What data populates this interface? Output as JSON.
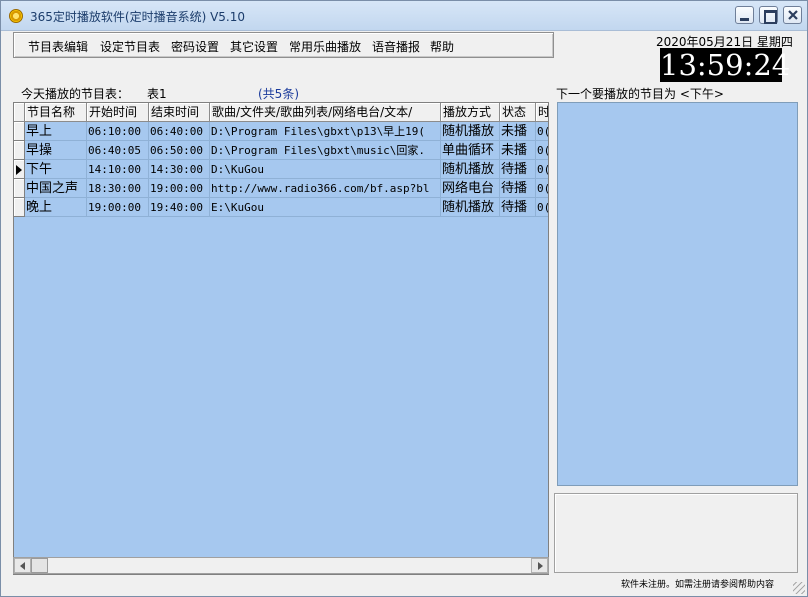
{
  "window": {
    "title": "365定时播放软件(定时播音系统) V5.10"
  },
  "menu": [
    "节目表编辑",
    "设定节目表",
    "密码设置",
    "其它设置",
    "常用乐曲播放",
    "语音播报",
    "帮助"
  ],
  "clock": {
    "date": "2020年05月21日 星期四",
    "time": "13:59:24"
  },
  "schedule": {
    "today_label": "今天播放的节目表：",
    "table_name": "表1",
    "count": "(共5条)",
    "columns": [
      "节目名称",
      "开始时间",
      "结束时间",
      "歌曲/文件夹/歌曲列表/网络电台/文本/",
      "播放方式",
      "状态",
      "时"
    ],
    "rows": [
      {
        "name": "早上",
        "start": "06:10:00",
        "end": "06:40:00",
        "path": "D:\\Program Files\\gbxt\\p13\\早上19(",
        "mode": "随机播放",
        "status": "未播",
        "extra": "0(",
        "active": false
      },
      {
        "name": "早操",
        "start": "06:40:05",
        "end": "06:50:00",
        "path": "D:\\Program Files\\gbxt\\music\\回家.",
        "mode": "单曲循环",
        "status": "未播",
        "extra": "0(",
        "active": false
      },
      {
        "name": "下午",
        "start": "14:10:00",
        "end": "14:30:00",
        "path": "D:\\KuGou",
        "mode": "随机播放",
        "status": "待播",
        "extra": "0(",
        "active": true
      },
      {
        "name": "中国之声",
        "start": "18:30:00",
        "end": "19:00:00",
        "path": "http://www.radio366.com/bf.asp?bl",
        "mode": "网络电台",
        "status": "待播",
        "extra": "0(",
        "active": false
      },
      {
        "name": "晚上",
        "start": "19:00:00",
        "end": "19:40:00",
        "path": "E:\\KuGou",
        "mode": "随机播放",
        "status": "待播",
        "extra": "0(",
        "active": false
      }
    ]
  },
  "next": {
    "label": "下一个要播放的节目为 <下午>"
  },
  "status_bar": {
    "text": "软件未注册。如需注册请参阅帮助内容"
  }
}
